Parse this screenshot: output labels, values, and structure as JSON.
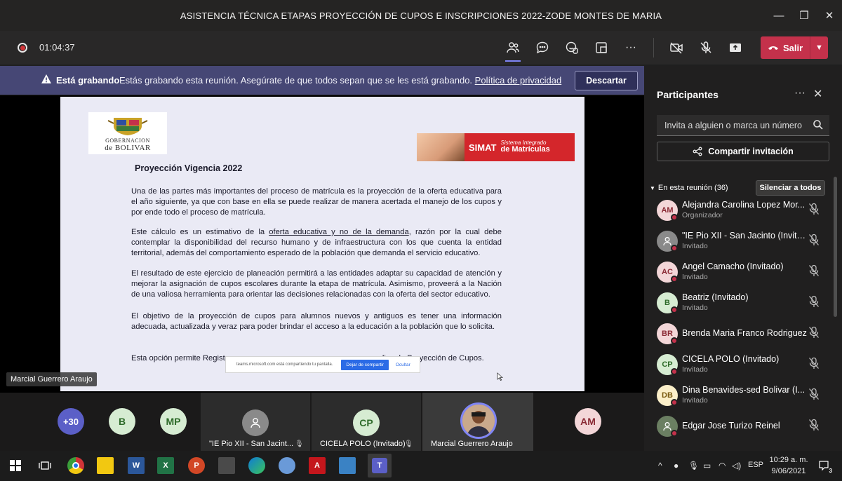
{
  "window": {
    "title": "ASISTENCIA TÉCNICA ETAPAS PROYECCIÓN DE CUPOS E INSCRIPCIONES 2022-ZODE MONTES DE MARIA",
    "minimize": "—",
    "maximize": "❐",
    "close": "✕"
  },
  "toolbar": {
    "timer": "01:04:37",
    "leave_label": "Salir",
    "more": "···"
  },
  "banner": {
    "title": "Está grabando",
    "text": "Estás grabando esta reunión. Asegúrate de que todos sepan que se les está grabando.",
    "link": "Política de privacidad",
    "dismiss": "Descartar"
  },
  "slide": {
    "logo_line1": "GOBERNACION",
    "logo_line2": "de BOLIVAR",
    "simat_brand": "SIMAT",
    "simat_sub1": "Sistema Integrado",
    "simat_sub2": "de Matrículas",
    "title": "Proyección Vigencia 2022",
    "p1": "Una de las partes más importantes del proceso de matrícula es la proyección de la oferta educativa para el año siguiente, ya que con base en ella se puede realizar de manera acertada el manejo de los cupos y por ende todo el proceso de matrícula.",
    "p2_a": "Este cálculo es un estimativo de la ",
    "p2_u": "oferta educativa y no de la demanda",
    "p2_b": ", razón por la cual debe contemplar la disponibilidad del recurso humano y de infraestructura con los que cuenta la entidad territorial, además del comportamiento esperado de la población que demanda el servicio educativo.",
    "p3": "El resultado de este ejercicio de planeación permitirá a las entidades adaptar su capacidad de atención y mejorar la asignación de cupos escolares durante la etapa de matrícula. Asimismo, proveerá a la Nación de una valiosa herramienta para orientar las decisiones relacionadas con la oferta del sector educativo.",
    "p4": "El objetivo de la proyección de cupos para alumnos nuevos y antiguos es tener una información adecuada, actualizada y veraz para poder brindar el acceso a la educación a la población que lo solicita.",
    "p5_a": "Esta opción permite Regist",
    "p5_b": "realizar la Proyección de Cupos.",
    "share_text": "teams.microsoft.com está compartiendo tu pantalla.",
    "share_stop": "Dejar de compartir",
    "share_hide": "Ocultar"
  },
  "presenter_name": "Marcial Guerrero Araujo",
  "gallery": {
    "overflow": "+30",
    "b": "B",
    "mp": "MP",
    "tile1_name": "\"IE Pio XII - San Jacint...",
    "tile2_initials": "CP",
    "tile2_name": "CICELA POLO (Invitado)",
    "tile3_name": "Marcial Guerrero Araujo",
    "am": "AM"
  },
  "panel": {
    "title": "Participantes",
    "more": "···",
    "close": "✕",
    "invite_placeholder": "Invita a alguien o marca un número",
    "share_invite": "Compartir invitación",
    "section": "En esta reunión (36)",
    "mute_all": "Silenciar a todos",
    "participants": [
      {
        "initials": "AM",
        "name": "Alejandra Carolina Lopez Mor...",
        "role": "Organizador",
        "color": "#f3d6d8",
        "text": "#8a2a35"
      },
      {
        "initials": "",
        "name": "\"IE Pio XII - San Jacinto (Invita...",
        "role": "Invitado",
        "color": "#8a8a8a",
        "text": "#ffffff"
      },
      {
        "initials": "AC",
        "name": "Angel Camacho (Invitado)",
        "role": "Invitado",
        "color": "#f3d6d8",
        "text": "#8a2a35"
      },
      {
        "initials": "B",
        "name": "Beatriz (Invitado)",
        "role": "Invitado",
        "color": "#d6ecd2",
        "text": "#2e6b2a"
      },
      {
        "initials": "BR",
        "name": "Brenda Maria Franco Rodriguez",
        "role": "",
        "color": "#f3d6d8",
        "text": "#8a2a35"
      },
      {
        "initials": "CP",
        "name": "CICELA POLO (Invitado)",
        "role": "Invitado",
        "color": "#d6ecd2",
        "text": "#2e6b2a"
      },
      {
        "initials": "DB",
        "name": "Dina Benavides-sed Bolivar (I...",
        "role": "Invitado",
        "color": "#fbefc9",
        "text": "#7a5a10"
      },
      {
        "initials": "",
        "name": "Edgar Jose Turizo Reinel",
        "role": "",
        "color": "#6b7f62",
        "text": "#ffffff"
      }
    ]
  },
  "taskbar": {
    "lang": "ESP",
    "time": "10:29 a. m.",
    "date": "9/06/2021",
    "notif_count": "3"
  }
}
